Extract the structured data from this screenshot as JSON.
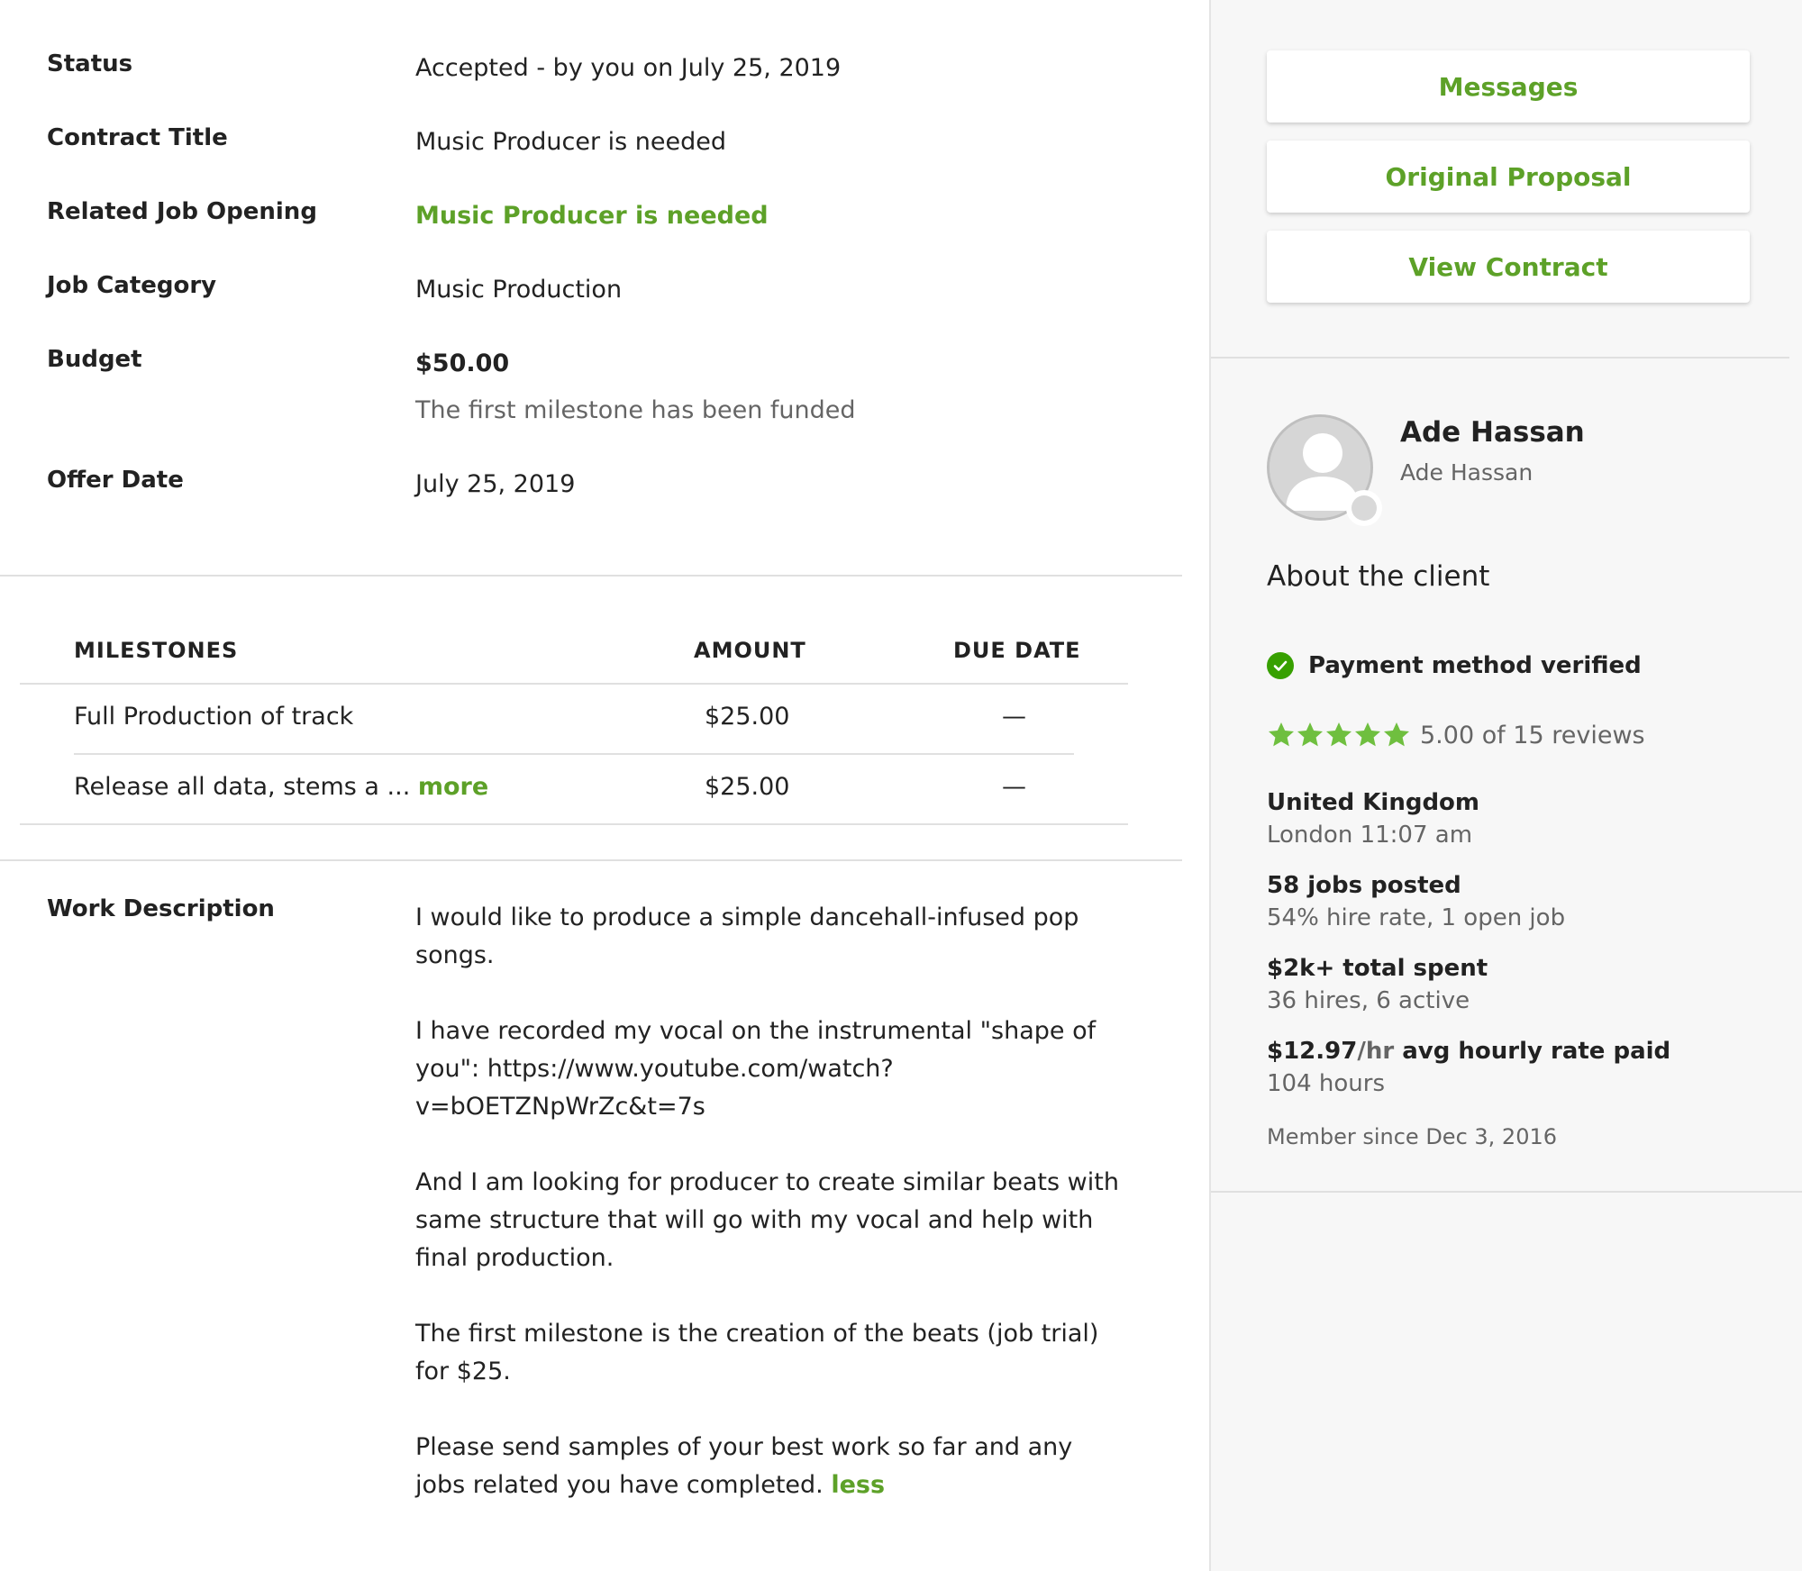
{
  "details": {
    "status": {
      "label": "Status",
      "value": "Accepted - by you on July 25, 2019"
    },
    "contract_title": {
      "label": "Contract Title",
      "value": "Music Producer is needed"
    },
    "related_job": {
      "label": "Related Job Opening",
      "value": "Music Producer is needed"
    },
    "job_category": {
      "label": "Job Category",
      "value": "Music Production"
    },
    "budget": {
      "label": "Budget",
      "value": "$50.00",
      "note": "The first milestone has been funded"
    },
    "offer_date": {
      "label": "Offer Date",
      "value": "July 25, 2019"
    }
  },
  "milestones": {
    "headers": {
      "name": "MILESTONES",
      "amount": "AMOUNT",
      "due": "DUE DATE"
    },
    "rows": [
      {
        "name": "Full Production of track",
        "amount": "$25.00",
        "due": "—"
      },
      {
        "name": "Release all data, stems a ...",
        "more": "more",
        "amount": "$25.00",
        "due": "—"
      }
    ]
  },
  "work_description": {
    "label": "Work Description",
    "paragraphs": [
      "I would like to produce a simple dancehall-infused pop songs.",
      "I have recorded my vocal on the instrumental \"shape of you\": https://www.youtube.com/watch?v=bOETZNpWrZc&t=7s",
      "And I am looking for producer to create similar beats with same structure that will go with my vocal and help with final production.",
      "The first milestone is the creation of the beats (job trial) for $25.",
      "Please send samples of your best work so far and any jobs related you have completed."
    ],
    "less_link": "less"
  },
  "sidebar": {
    "buttons": {
      "messages": "Messages",
      "proposal": "Original Proposal",
      "contract": "View Contract"
    },
    "client": {
      "name": "Ade Hassan",
      "subname": "Ade Hassan",
      "about": "About the client",
      "payment": "Payment method verified",
      "rating_value": 5.0,
      "rating_text": "5.00 of 15 reviews",
      "country": "United Kingdom",
      "city_time": "London 11:07 am",
      "jobs_posted": "58 jobs posted",
      "hire_rate": "54% hire rate, 1 open job",
      "total_spent": "$2k+ total spent",
      "hires": "36 hires, 6 active",
      "hourly_amount": "$12.97",
      "hourly_unit": "/hr",
      "hourly_label": " avg hourly rate paid",
      "hours": "104 hours",
      "member_since": "Member since Dec 3, 2016"
    }
  },
  "colors": {
    "accent": "#5da128",
    "verified": "#37a000",
    "star": "#6fbf3f"
  }
}
